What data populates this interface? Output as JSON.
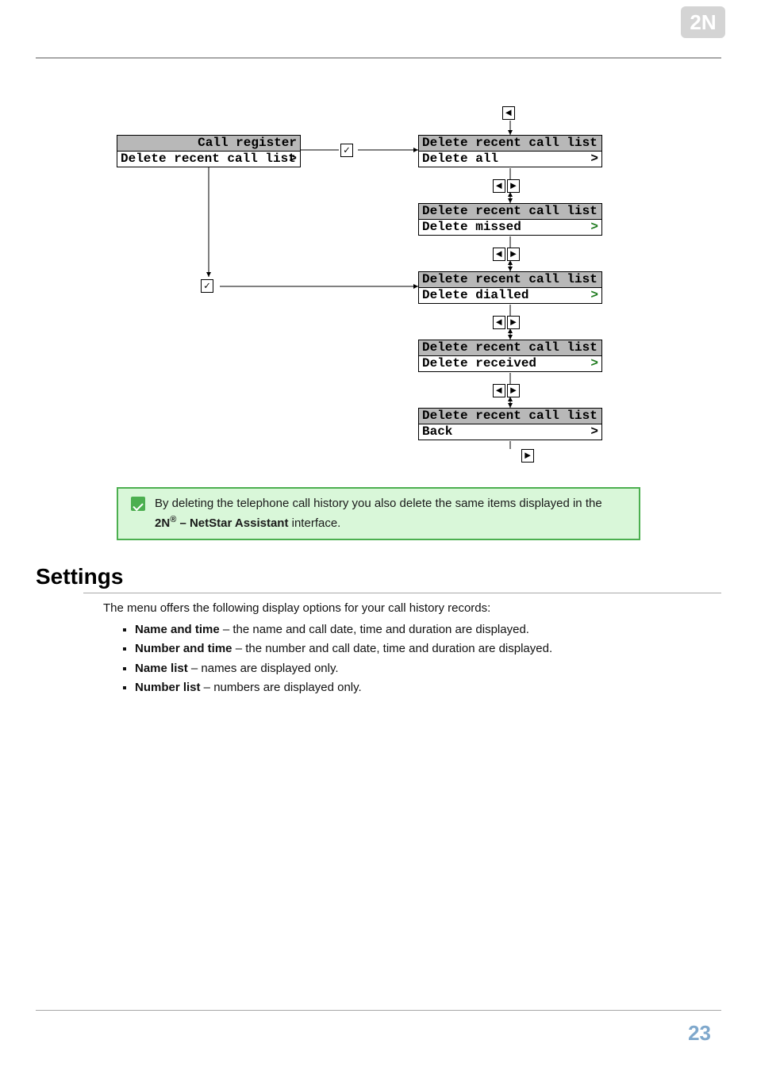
{
  "page_number": "23",
  "diagram": {
    "left_box": {
      "title": "Call register",
      "row": "Delete recent call list",
      "arrow": ">"
    },
    "right_boxes": [
      {
        "title": "Delete recent call list",
        "row": "Delete all",
        "green": false
      },
      {
        "title": "Delete recent call list",
        "row": "Delete missed",
        "green": true
      },
      {
        "title": "Delete recent call list",
        "row": "Delete dialled",
        "green": true
      },
      {
        "title": "Delete recent call list",
        "row": "Delete received",
        "green": true
      },
      {
        "title": "Delete recent call list",
        "row": "Back",
        "green": false
      }
    ],
    "key_left": "◄",
    "key_right": "►",
    "key_check": "✓"
  },
  "tip": {
    "text_prefix": "By deleting the telephone call history you also delete the same items displayed in the ",
    "product": "2N",
    "reg": "®",
    "product_suffix": " – NetStar Assistant",
    "text_suffix": " interface."
  },
  "settings": {
    "heading": "Settings",
    "intro": "The menu offers the following display options for your call history records:",
    "items": [
      {
        "bold": "Name and time",
        "rest": " – the name and call date, time and duration are displayed."
      },
      {
        "bold": "Number and time",
        "rest": " – the number and call date, time and duration are displayed."
      },
      {
        "bold": "Name list",
        "rest": " – names are displayed only."
      },
      {
        "bold": "Number list",
        "rest": " – numbers are displayed only."
      }
    ]
  }
}
